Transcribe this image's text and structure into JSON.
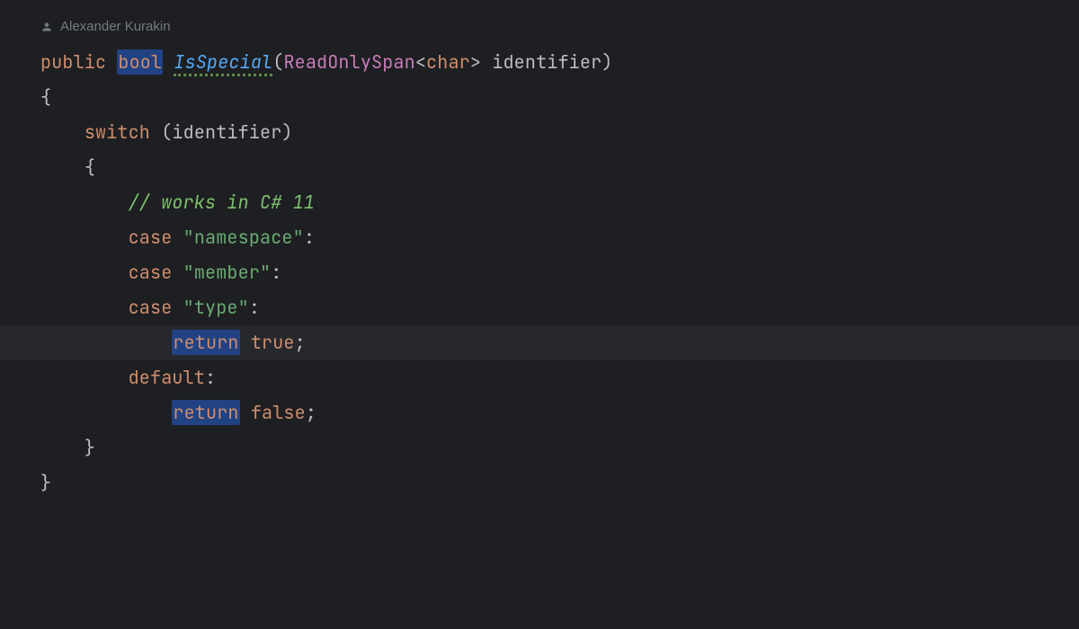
{
  "author": {
    "name": "Alexander Kurakin"
  },
  "code": {
    "signature": {
      "public": "public",
      "bool": "bool",
      "method": "IsSpecial",
      "paramType": "ReadOnlySpan",
      "paramGeneric": "char",
      "paramName": "identifier"
    },
    "switchKw": "switch",
    "switchArg": "identifier",
    "comment": "// works in C# 11",
    "case1": {
      "kw": "case",
      "val": "\"namespace\""
    },
    "case2": {
      "kw": "case",
      "val": "\"member\""
    },
    "case3": {
      "kw": "case",
      "val": "\"type\""
    },
    "ret1": {
      "kw": "return",
      "val": "true"
    },
    "defaultKw": "default",
    "ret2": {
      "kw": "return",
      "val": "false"
    }
  }
}
